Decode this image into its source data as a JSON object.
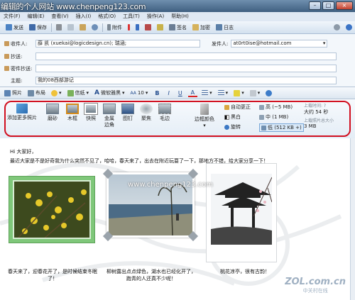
{
  "window": {
    "title": "编辑的个人网站 www.chenpeng123.com"
  },
  "menu": [
    "文件(F)",
    "编辑(E)",
    "查看(V)",
    "插入(I)",
    "格式(O)",
    "工具(T)",
    "操作(A)",
    "帮助(H)"
  ],
  "toolbar": {
    "send": "发送",
    "save": "保存",
    "attach": "附件",
    "sign": "签名",
    "encrypt": "加密",
    "log": "日志"
  },
  "header": {
    "to_label": "收件人:",
    "to_value": "薛 凯 (xuekai@logicdesign.cn); 瑞涵;",
    "from_label": "发件人:",
    "from_value": "at0rt0ise@hotmail.com",
    "cc_label": "抄送:",
    "bcc_label": "密件抄送:",
    "subject_label": "主题:",
    "subject_value": "我的08西部游记"
  },
  "format_bar": {
    "photo": "照片",
    "layout": "布局",
    "stationery": "信纸",
    "font": "微软雅黑",
    "size": "10",
    "bold": "B",
    "italic": "I",
    "underline": "U",
    "color": "A"
  },
  "ribbon": {
    "add_photos": "添加更多照片",
    "styles": [
      "磨砂",
      "木框",
      "快照",
      "金属边角",
      "图钉",
      "聚焦",
      "毛边"
    ],
    "border_color": "边框颜色",
    "auto_correct": "自动更正",
    "bw": "黑白",
    "rotate": "旋转",
    "size_high": "高 (~5 MB)",
    "size_mid": "中 (1 MB)",
    "size_low": "低 (512 KB +)",
    "upload_time_label": "上载时间: ?",
    "upload_time_value": "大约 54 秒",
    "upload_size_label": "上载照片总大小",
    "upload_size_value": "3 MB"
  },
  "body": {
    "greeting": "Hi 大家好，",
    "line1": "最近大家是不是好奇我为什么突然不见了，哈哈，春天来了，出去在附近玩耍了一下，那地方不错，给大家分享一下！",
    "captions": [
      "春天来了，迎春花开了，是时候结束冬眠了！",
      "柳树露出点点绿色，湖水也已经化开了，跑青的人还真不少呢！",
      "桃花凉亭，很有古韵！"
    ]
  },
  "watermark": {
    "url": "www.chenpeng123.com",
    "zol_logo": "ZOL.com.cn",
    "zol_sub": "中关村在线"
  },
  "colors": {
    "accent": "#d10f1f",
    "header_bg": "#f3f7fb",
    "chrome": "#cfe0f3"
  }
}
